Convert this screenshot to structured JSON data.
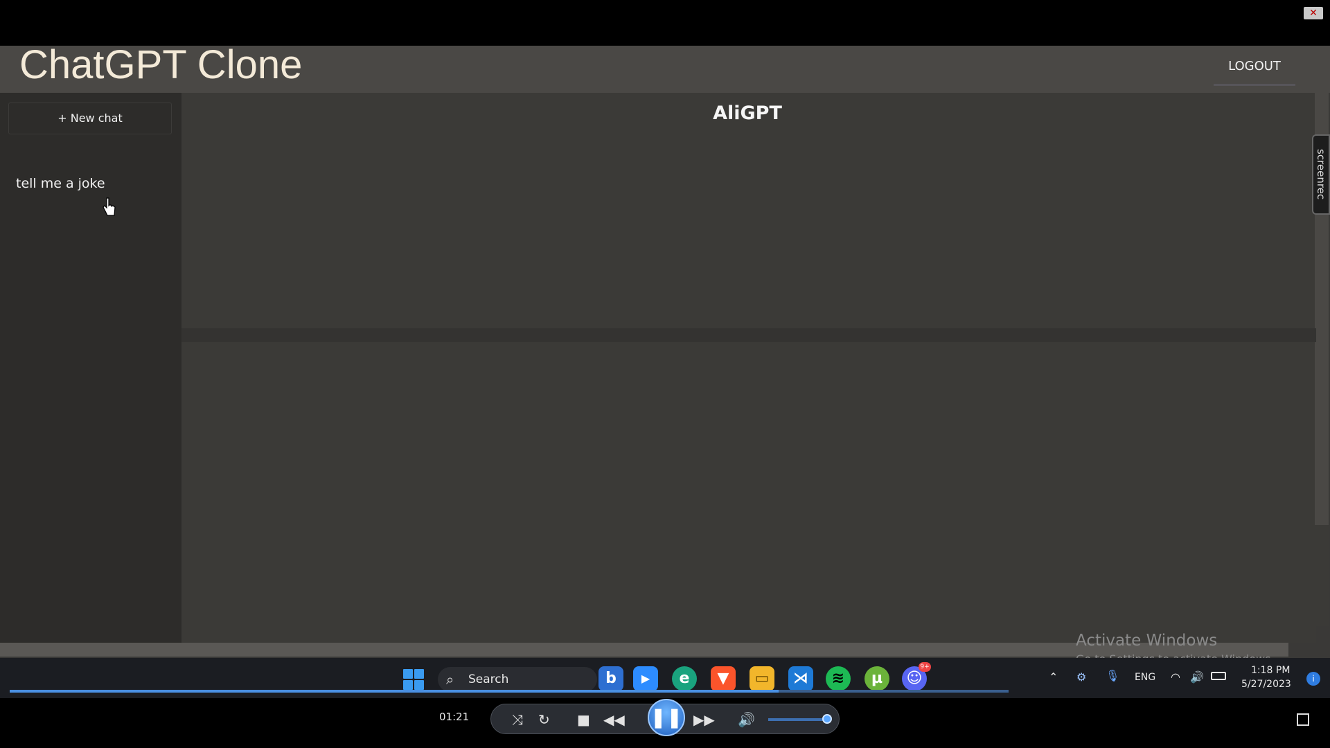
{
  "window": {
    "close_glyph": "✕"
  },
  "app": {
    "title": "ChatGPT Clone",
    "logout_label": "LOGOUT",
    "sidebar": {
      "new_chat_label": "+ New chat",
      "history": [
        "tell me a joke"
      ]
    },
    "main": {
      "brand": "AliGPT"
    },
    "overlay_tab": "screenrec"
  },
  "taskbar": {
    "search_label": "Search",
    "icons": [
      "bing-icon",
      "zoom-icon",
      "edge-icon",
      "brave-icon",
      "file-explorer-icon",
      "vscode-icon",
      "spotify-icon",
      "utorrent-icon",
      "discord-icon"
    ],
    "discord_badge": "9+"
  },
  "watermark": {
    "line1": "Activate Windows",
    "line2": "Go to Settings to activate Windows."
  },
  "tray": {
    "language": "ENG",
    "time": "1:18 PM",
    "date": "5/27/2023"
  },
  "player": {
    "elapsed": "01:21",
    "progress_fraction": 0.77
  },
  "colors": {
    "header_bg": "#4a4845",
    "sidebar_bg": "#2d2c2a",
    "main_bg": "#3b3a37",
    "title_color": "#f4ead8",
    "accent_blue": "#4a90e2"
  }
}
